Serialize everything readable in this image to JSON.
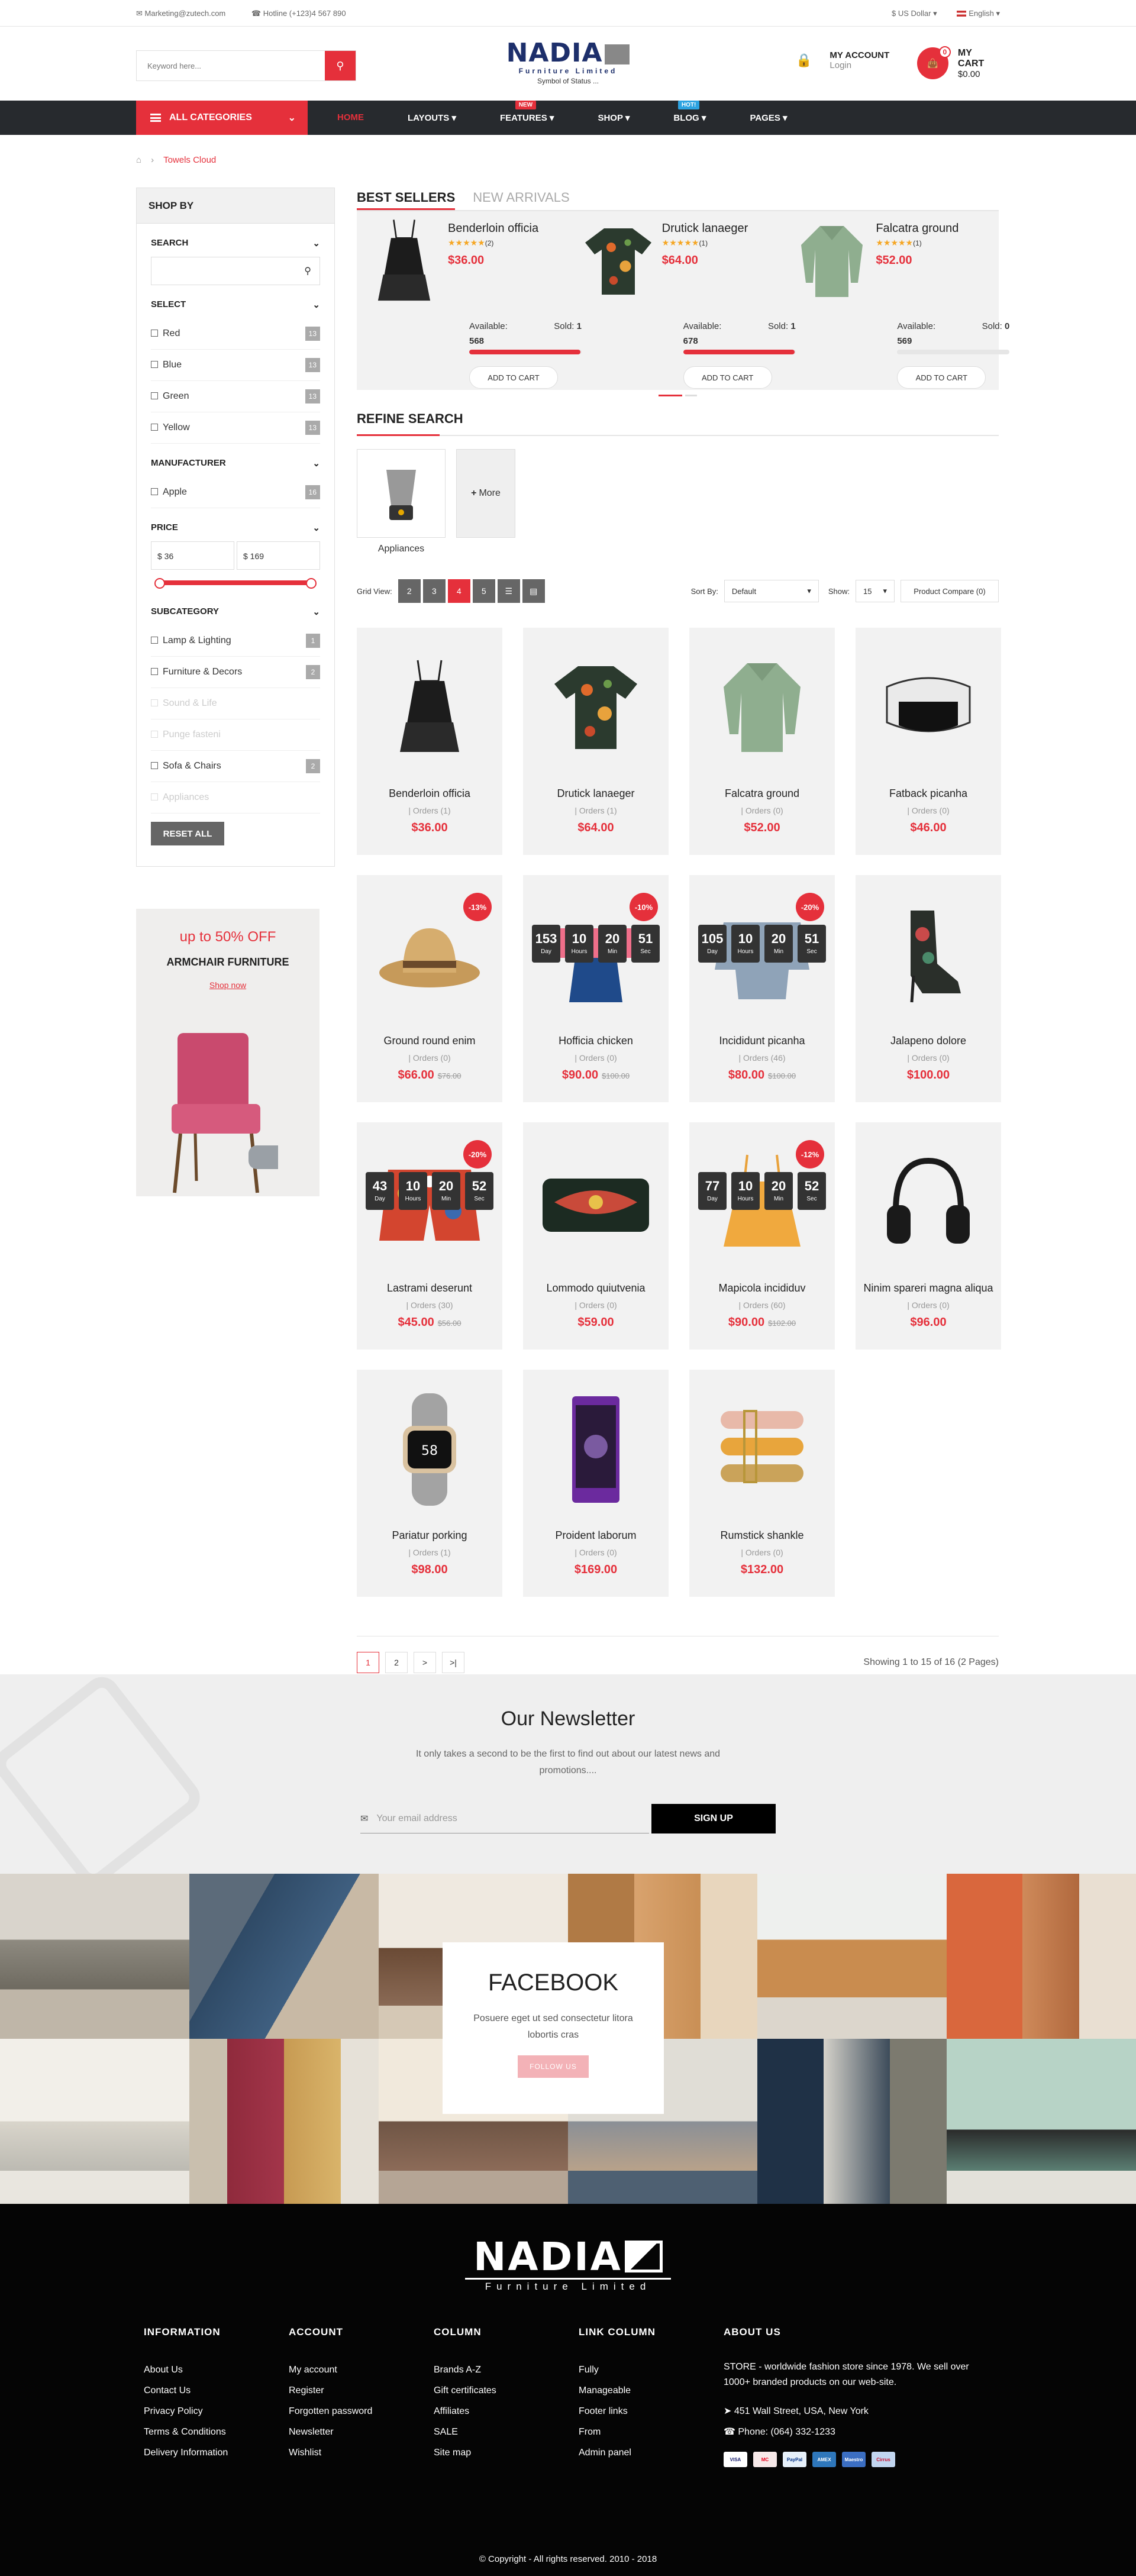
{
  "topbar": {
    "email": "Marketing@zutech.com",
    "hotline": "Hotline (+123)4 567 890",
    "currency": "$ US Dollar",
    "language": "English"
  },
  "header": {
    "search_placeholder": "Keyword here...",
    "logo_name": "NADIA",
    "logo_sub": "Furniture Limited",
    "logo_tag": "Symbol of Status ...",
    "account_title": "MY ACCOUNT",
    "account_login": "Login",
    "cart_count": "0",
    "cart_title": "MY CART",
    "cart_total": "$0.00"
  },
  "nav": {
    "all_categories": "ALL CATEGORIES",
    "items": [
      {
        "label": "HOME",
        "badge": ""
      },
      {
        "label": "LAYOUTS",
        "badge": ""
      },
      {
        "label": "FEATURES",
        "badge": "NEW"
      },
      {
        "label": "SHOP",
        "badge": ""
      },
      {
        "label": "BLOG",
        "badge": "HOT!"
      },
      {
        "label": "PAGES",
        "badge": ""
      }
    ]
  },
  "breadcrumb": {
    "current": "Towels Cloud"
  },
  "sidebar": {
    "title": "SHOP BY",
    "search_title": "SEARCH",
    "select_title": "SELECT",
    "colors": [
      {
        "label": "Red",
        "count": "13"
      },
      {
        "label": "Blue",
        "count": "13"
      },
      {
        "label": "Green",
        "count": "13"
      },
      {
        "label": "Yellow",
        "count": "13"
      }
    ],
    "manufacturer_title": "MANUFACTURER",
    "manufacturers": [
      {
        "label": "Apple",
        "count": "16"
      }
    ],
    "price_title": "PRICE",
    "price_min": "$ 36",
    "price_max": "$ 169",
    "subcategory_title": "SUBCATEGORY",
    "subcategories": [
      {
        "label": "Lamp & Lighting",
        "count": "1"
      },
      {
        "label": "Furniture & Decors",
        "count": "2"
      },
      {
        "label": "Sound & Life",
        "count": ""
      },
      {
        "label": "Punge fasteni",
        "count": ""
      },
      {
        "label": "Sofa & Chairs",
        "count": "2"
      },
      {
        "label": "Appliances",
        "count": ""
      }
    ],
    "reset_label": "RESET ALL"
  },
  "promo": {
    "line1": "up to 50% OFF",
    "line2": "ARMCHAIR FURNITURE",
    "link": "Shop now"
  },
  "tabs": [
    "BEST SELLERS",
    "NEW ARRIVALS"
  ],
  "best_sellers": [
    {
      "name": "Benderloin officia",
      "reviews": "(2)",
      "price": "$36.00",
      "available_label": "Available:",
      "sold_label": "Sold:",
      "sold": "1",
      "available": "568",
      "progress": 0.99,
      "cart": "ADD TO CART"
    },
    {
      "name": "Drutick lanaeger",
      "reviews": "(1)",
      "price": "$64.00",
      "available_label": "Available:",
      "sold_label": "Sold:",
      "sold": "1",
      "available": "678",
      "progress": 0.99,
      "cart": "ADD TO CART"
    },
    {
      "name": "Falcatra ground",
      "reviews": "(1)",
      "price": "$52.00",
      "available_label": "Available:",
      "sold_label": "Sold:",
      "sold": "0",
      "available": "569",
      "progress": 0.0,
      "cart": "ADD TO CART"
    }
  ],
  "refine": {
    "title": "REFINE SEARCH",
    "category": "Appliances",
    "more": "More"
  },
  "toolbar": {
    "grid_view": "Grid View:",
    "grid_options": [
      "2",
      "3",
      "4",
      "5"
    ],
    "sort_label": "Sort By:",
    "sort_value": "Default",
    "show_label": "Show:",
    "show_value": "15",
    "compare": "Product Compare (0)"
  },
  "products": [
    {
      "name": "Benderloin officia",
      "orders": "Orders (1)",
      "price": "$36.00",
      "old": "",
      "sale": "",
      "countdown": null
    },
    {
      "name": "Drutick lanaeger",
      "orders": "Orders (1)",
      "price": "$64.00",
      "old": "",
      "sale": "",
      "countdown": null
    },
    {
      "name": "Falcatra ground",
      "orders": "Orders (0)",
      "price": "$52.00",
      "old": "",
      "sale": "",
      "countdown": null
    },
    {
      "name": "Fatback picanha",
      "orders": "Orders (0)",
      "price": "$46.00",
      "old": "",
      "sale": "",
      "countdown": null
    },
    {
      "name": "Ground round enim",
      "orders": "Orders (0)",
      "price": "$66.00",
      "old": "$76.00",
      "sale": "-13%",
      "countdown": null
    },
    {
      "name": "Hofficia chicken",
      "orders": "Orders (0)",
      "price": "$90.00",
      "old": "$100.00",
      "sale": "-10%",
      "countdown": [
        "153",
        "10",
        "20",
        "51"
      ]
    },
    {
      "name": "Incididunt picanha",
      "orders": "Orders (46)",
      "price": "$80.00",
      "old": "$100.00",
      "sale": "-20%",
      "countdown": [
        "105",
        "10",
        "20",
        "51"
      ]
    },
    {
      "name": "Jalapeno dolore",
      "orders": "Orders (0)",
      "price": "$100.00",
      "old": "",
      "sale": "",
      "countdown": null
    },
    {
      "name": "Lastrami deserunt",
      "orders": "Orders (30)",
      "price": "$45.00",
      "old": "$56.00",
      "sale": "-20%",
      "countdown": [
        "43",
        "10",
        "20",
        "52"
      ]
    },
    {
      "name": "Lommodo quiutvenia",
      "orders": "Orders (0)",
      "price": "$59.00",
      "old": "",
      "sale": "",
      "countdown": null
    },
    {
      "name": "Mapicola incididuv",
      "orders": "Orders (60)",
      "price": "$90.00",
      "old": "$102.00",
      "sale": "-12%",
      "countdown": [
        "77",
        "10",
        "20",
        "52"
      ]
    },
    {
      "name": "Ninim spareri magna aliqua",
      "orders": "Orders (0)",
      "price": "$96.00",
      "old": "",
      "sale": "",
      "countdown": null
    },
    {
      "name": "Pariatur porking",
      "orders": "Orders (1)",
      "price": "$98.00",
      "old": "",
      "sale": "",
      "countdown": null
    },
    {
      "name": "Proident laborum",
      "orders": "Orders (0)",
      "price": "$169.00",
      "old": "",
      "sale": "",
      "countdown": null
    },
    {
      "name": "Rumstick shankle",
      "orders": "Orders (0)",
      "price": "$132.00",
      "old": "",
      "sale": "",
      "countdown": null
    }
  ],
  "countdown_units": [
    "Day",
    "Hours",
    "Min",
    "Sec"
  ],
  "pagination": {
    "pages": [
      "1",
      "2",
      ">",
      ">|"
    ],
    "summary": "Showing 1 to 15 of 16 (2 Pages)"
  },
  "newsletter": {
    "title": "Our Newsletter",
    "text": "It only takes a second to be the first to find out about our latest news and promotions....",
    "placeholder": "Your email address",
    "button": "SIGN UP"
  },
  "facebook": {
    "title": "FACEBOOK",
    "text": "Posuere eget ut sed consectetur litora lobortis cras",
    "button": "FOLLOW US"
  },
  "footer": {
    "logo_name": "NADIA",
    "logo_sub": "Furniture Limited",
    "columns": [
      {
        "title": "INFORMATION",
        "links": [
          "About Us",
          "Contact Us",
          "Privacy Policy",
          "Terms & Conditions",
          "Delivery Information"
        ]
      },
      {
        "title": "ACCOUNT",
        "links": [
          "My account",
          "Register",
          "Forgotten password",
          "Newsletter",
          "Wishlist"
        ]
      },
      {
        "title": "COLUMN",
        "links": [
          "Brands A-Z",
          "Gift certificates",
          "Affiliates",
          "SALE",
          "Site map"
        ]
      },
      {
        "title": "LINK COLUMN",
        "links": [
          "Fully",
          "Manageable",
          "Footer links",
          "From",
          "Admin panel"
        ]
      }
    ],
    "about_title": "ABOUT US",
    "about_text": "STORE - worldwide fashion store since 1978. We sell over 1000+ branded products on our web-site.",
    "address": "451 Wall Street, USA, New York",
    "phone": "Phone: (064) 332-1233",
    "payments": [
      "VISA",
      "MC",
      "PayPal",
      "AMEX",
      "Maestro",
      "Cirrus"
    ],
    "copyright": "© Copyright - All rights reserved. 2010 - 2018"
  }
}
